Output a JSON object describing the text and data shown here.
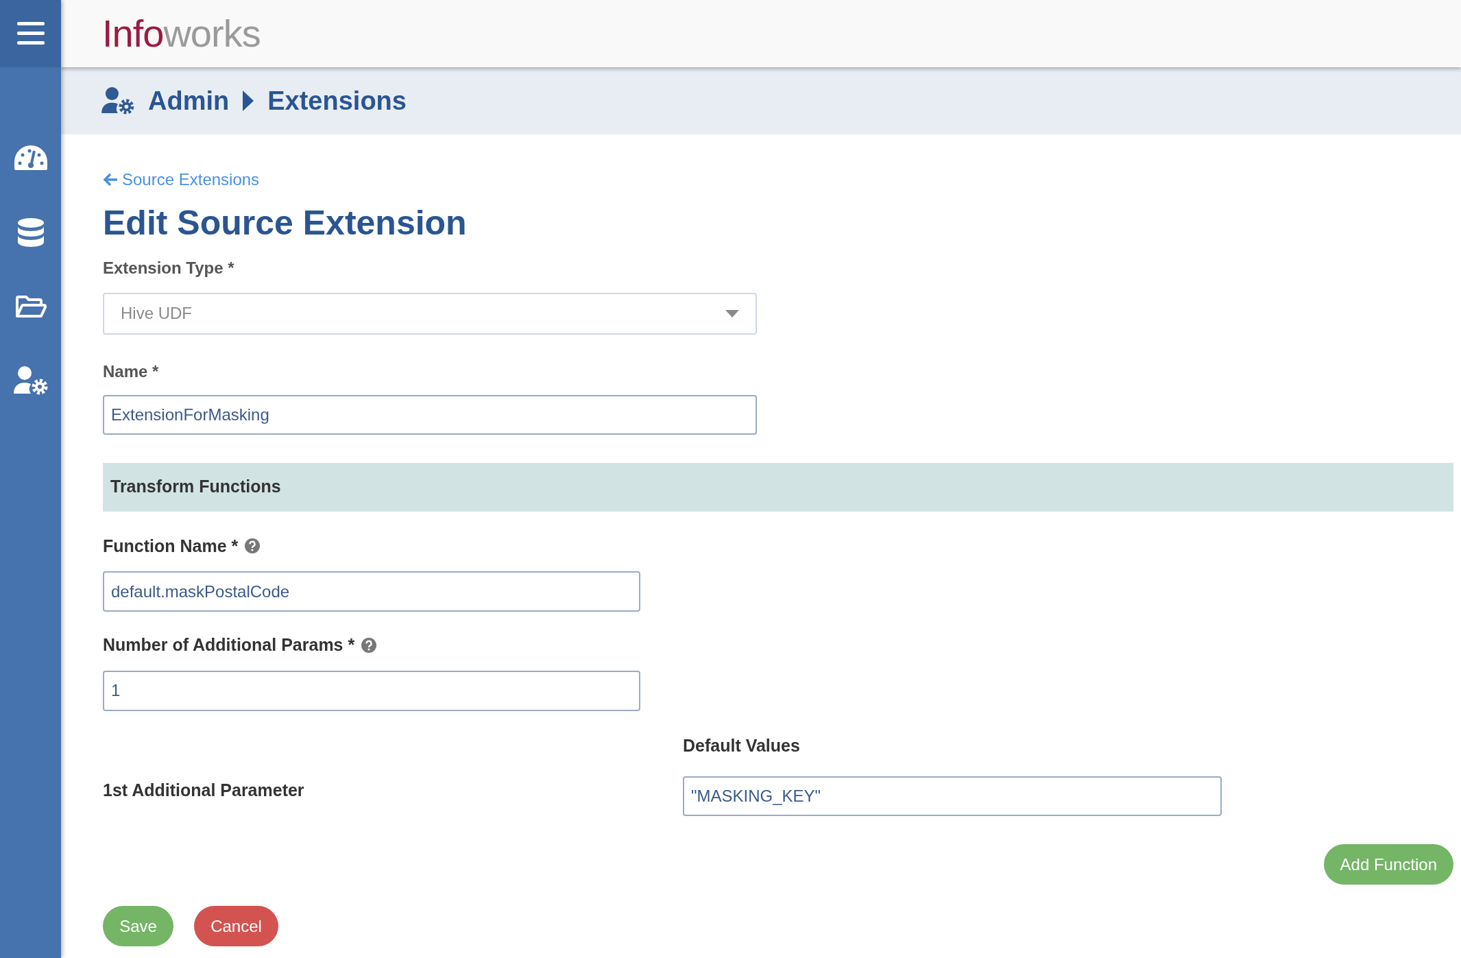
{
  "header": {
    "logo": [
      "Info",
      "works"
    ]
  },
  "breadcrumb": [
    "Admin",
    "Extensions"
  ],
  "back_link": "Source Extensions",
  "title": "Edit Source Extension",
  "fields": [
    {
      "kind": "select",
      "label": "Extension Type *",
      "value": "Hive UDF",
      "disabled": true
    },
    {
      "kind": "text",
      "label": "Name *",
      "value": "ExtensionForMasking",
      "disabled": false
    }
  ],
  "section": {
    "title": "Transform Functions",
    "fields": [
      {
        "label": "Function Name *",
        "value": "default.maskPostalCode"
      },
      {
        "label": "Number of Additional Params *",
        "value": "1"
      }
    ],
    "default_values_heading": "Default Values",
    "params": [
      {
        "label": "1st Additional Parameter",
        "value": "\"MASKING_KEY\""
      }
    ],
    "add_button": "Add Function"
  },
  "buttons": [
    {
      "kind": "save",
      "label": "Save"
    },
    {
      "kind": "cancel",
      "label": "Cancel"
    }
  ]
}
